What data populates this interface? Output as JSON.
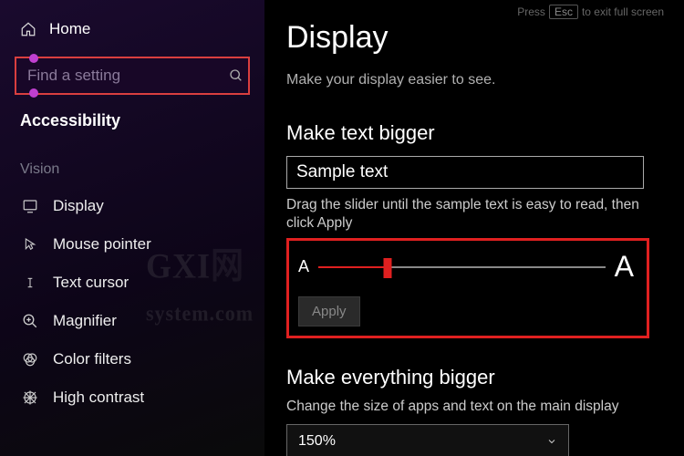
{
  "sidebar": {
    "home_label": "Home",
    "search_placeholder": "Find a setting",
    "accessibility_title": "Accessibility",
    "section_label": "Vision",
    "items": [
      {
        "label": "Display",
        "icon": "display"
      },
      {
        "label": "Mouse pointer",
        "icon": "mouse"
      },
      {
        "label": "Text cursor",
        "icon": "cursor"
      },
      {
        "label": "Magnifier",
        "icon": "magnifier"
      },
      {
        "label": "Color filters",
        "icon": "colorfilters"
      },
      {
        "label": "High contrast",
        "icon": "highcontrast"
      }
    ]
  },
  "exit_hint": {
    "prefix": "Press",
    "key": "Esc",
    "suffix": "to exit full screen"
  },
  "main": {
    "title": "Display",
    "subtitle": "Make your display easier to see.",
    "text_bigger": {
      "heading": "Make text bigger",
      "sample": "Sample text",
      "instruction": "Drag the slider until the sample text is easy to read, then click Apply",
      "letter_small": "A",
      "letter_big": "A",
      "apply_label": "Apply",
      "slider_percent": 24
    },
    "everything_bigger": {
      "heading": "Make everything bigger",
      "description": "Change the size of apps and text on the main display",
      "value": "150%"
    }
  },
  "watermark": {
    "prefix": "GXI",
    "suffix": "system.com"
  }
}
